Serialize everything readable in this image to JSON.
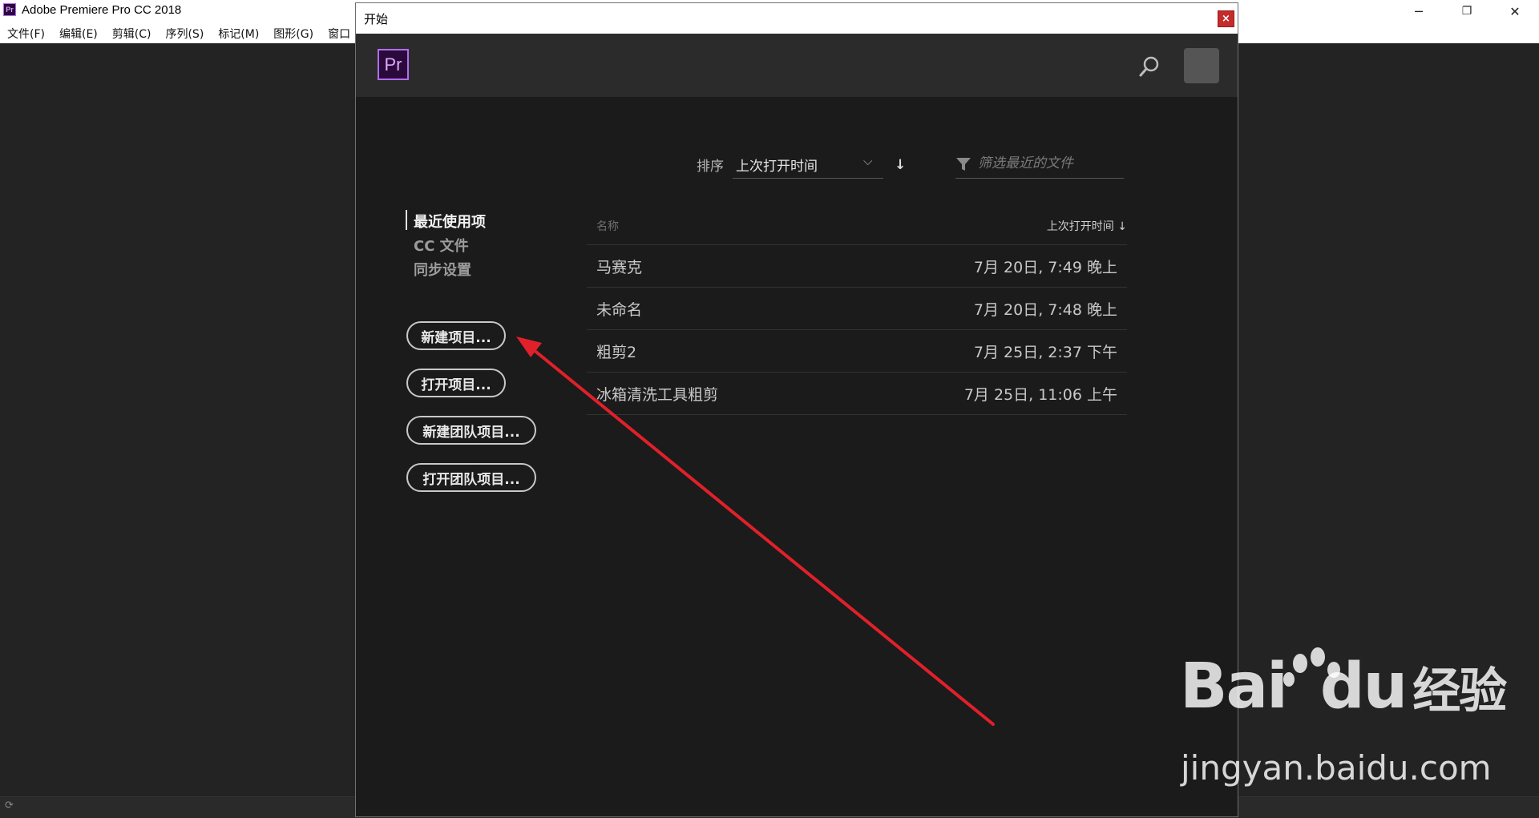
{
  "app": {
    "title": "Adobe Premiere Pro CC 2018",
    "icon_text": "Pr",
    "window_controls": [
      "─",
      "❐",
      "✕"
    ]
  },
  "menubar": {
    "items": [
      "文件(F)",
      "编辑(E)",
      "剪辑(C)",
      "序列(S)",
      "标记(M)",
      "图形(G)",
      "窗口"
    ]
  },
  "dialog": {
    "title": "开始",
    "close": "×",
    "logo_text": "Pr",
    "sort": {
      "label": "排序",
      "value": "上次打开时间",
      "direction": "↓"
    },
    "filter": {
      "placeholder": "筛选最近的文件"
    },
    "nav": [
      {
        "label": "最近使用项",
        "active": true
      },
      {
        "label": "CC 文件",
        "active": false
      },
      {
        "label": "同步设置",
        "active": false
      }
    ],
    "buttons": {
      "new_project": "新建项目...",
      "open_project": "打开项目...",
      "new_team_project": "新建团队项目...",
      "open_team_project": "打开团队项目..."
    },
    "table": {
      "col_name": "名称",
      "col_date": "上次打开时间",
      "col_date_sort": "↓",
      "rows": [
        {
          "name": "马赛克",
          "date": "7月 20日, 7:49 晚上"
        },
        {
          "name": "未命名",
          "date": "7月 20日, 7:48 晚上"
        },
        {
          "name": "粗剪2",
          "date": "7月 25日, 2:37 下午"
        },
        {
          "name": "冰箱清洗工具粗剪",
          "date": "7月 25日, 11:06 上午"
        }
      ]
    }
  },
  "watermark": {
    "brand": "Bai",
    "brand2": "du",
    "product": "经验",
    "url": "jingyan.baidu.com"
  },
  "colors": {
    "pr_purple": "#b26cf3",
    "annotation_arrow": "#e0202a"
  }
}
